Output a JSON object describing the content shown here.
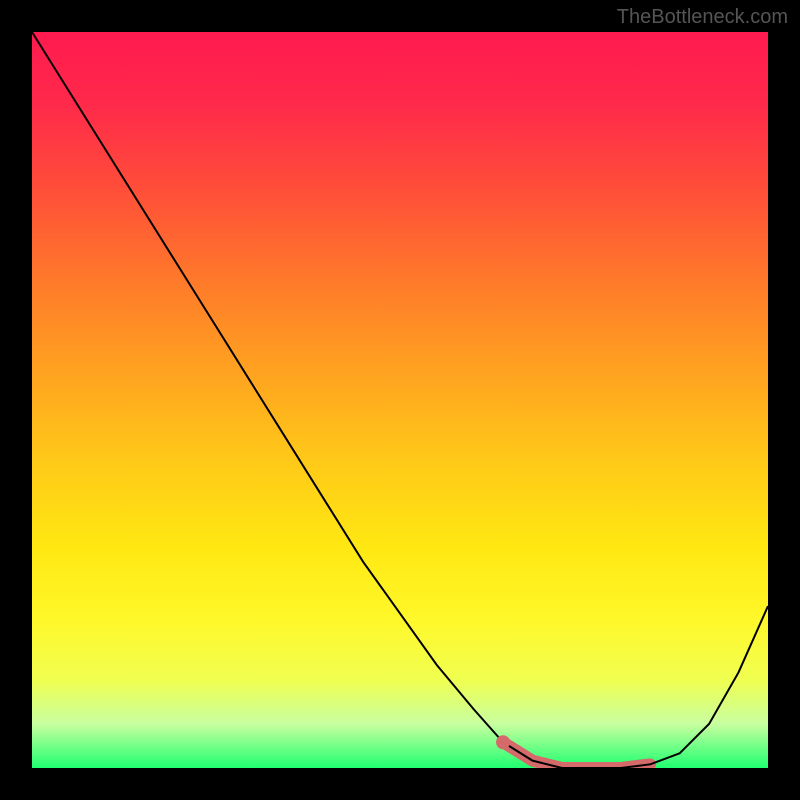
{
  "watermark": "TheBottleneck.com",
  "chart_data": {
    "type": "line",
    "title": "",
    "xlabel": "",
    "ylabel": "",
    "xlim": [
      0,
      100
    ],
    "ylim": [
      0,
      100
    ],
    "x": [
      0,
      5,
      10,
      15,
      20,
      25,
      30,
      35,
      40,
      45,
      50,
      55,
      60,
      64,
      68,
      72,
      76,
      80,
      84,
      88,
      92,
      96,
      100
    ],
    "y": [
      100,
      92,
      84,
      76,
      68,
      60,
      52,
      44,
      36,
      28,
      21,
      14,
      8,
      3.5,
      1,
      0,
      0,
      0,
      0.5,
      2,
      6,
      13,
      22
    ],
    "highlight_band": {
      "x_start": 64,
      "x_end": 84,
      "color": "#d46a6a",
      "thickness": 12
    },
    "gradient_background": {
      "top_color": "#ff1a50",
      "bottom_color": "#20ff70",
      "orientation": "vertical"
    }
  }
}
